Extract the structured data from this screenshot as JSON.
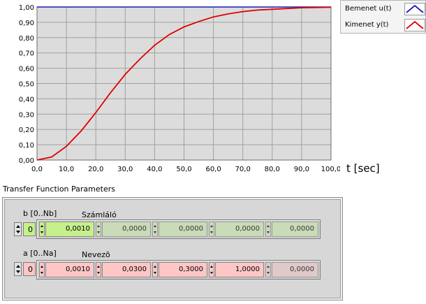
{
  "chart_data": {
    "type": "line",
    "xlabel": "t [sec]",
    "xlim": [
      0,
      100
    ],
    "ylim": [
      0,
      1
    ],
    "grid": true,
    "legend_placement": "right",
    "x_ticks": [
      "0,0",
      "10,0",
      "20,0",
      "30,0",
      "40,0",
      "50,0",
      "60,0",
      "70,0",
      "80,0",
      "90,0",
      "100,0"
    ],
    "y_ticks": [
      "0,00",
      "0,10",
      "0,20",
      "0,30",
      "0,40",
      "0,50",
      "0,60",
      "0,70",
      "0,80",
      "0,90",
      "1,00"
    ],
    "x": [
      0,
      5,
      10,
      15,
      20,
      25,
      30,
      35,
      40,
      45,
      50,
      55,
      60,
      65,
      70,
      75,
      80,
      85,
      90,
      95,
      100
    ],
    "series": [
      {
        "name": "Bemenet u(t)",
        "color": "#1a1ab8",
        "values": [
          1,
          1,
          1,
          1,
          1,
          1,
          1,
          1,
          1,
          1,
          1,
          1,
          1,
          1,
          1,
          1,
          1,
          1,
          1,
          1,
          1
        ]
      },
      {
        "name": "Kimenet y(t)",
        "color": "#e00000",
        "values": [
          0.0,
          0.02,
          0.09,
          0.19,
          0.31,
          0.44,
          0.56,
          0.66,
          0.75,
          0.82,
          0.87,
          0.905,
          0.935,
          0.955,
          0.97,
          0.98,
          0.985,
          0.99,
          0.995,
          0.997,
          0.998
        ]
      }
    ]
  },
  "colors": {
    "plot_bg": "#dcdcdc",
    "grid": "#a0a0a0",
    "active_cell_b": "#c6f08c",
    "active_cell_a": "#ffc6c6",
    "inactive_cell": "#c8e0b0",
    "inactive_cell_a": "#e8c8c8"
  },
  "section_title": "Transfer Function Parameters",
  "numerator": {
    "index_label": "b [0..Nb]",
    "index_value": "0",
    "title": "Számláló",
    "cells": [
      "0,0010",
      "0,0000",
      "0,0000",
      "0,0000",
      "0,0000"
    ]
  },
  "denominator": {
    "index_label": "a [0..Na]",
    "index_value": "0",
    "title": "Nevezõ",
    "cells": [
      "0,0010",
      "0,0300",
      "0,3000",
      "1,0000",
      "0,0000"
    ]
  },
  "icons": [
    "spin-up-down-icon",
    "legend-blue-line-icon",
    "legend-red-line-icon"
  ]
}
